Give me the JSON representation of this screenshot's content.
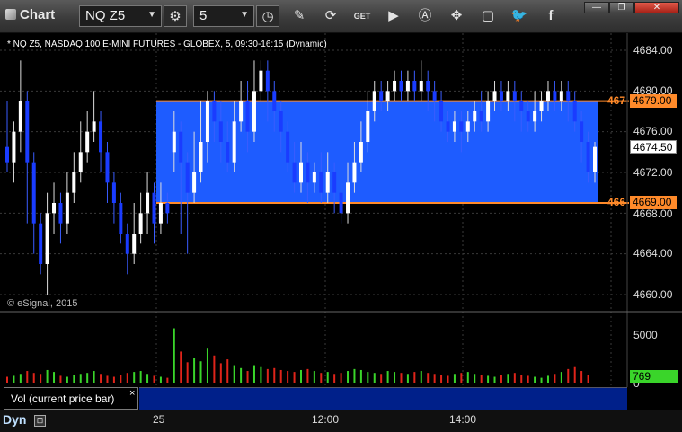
{
  "toolbar": {
    "title": "Chart",
    "symbol": "NQ Z5",
    "interval": "5",
    "icons": [
      "clock-settings-icon",
      "interval-clock-icon",
      "pencil-icon",
      "refresh-icon",
      "get-icon",
      "play-icon",
      "alert-icon",
      "link-icon",
      "chat-icon",
      "twitter-icon",
      "facebook-icon"
    ],
    "get_label": "GET"
  },
  "chart": {
    "header": "* NQ Z5, NASDAQ 100 E-MINI FUTURES - GLOBEX, 5, 09:30-16:15 (Dynamic)",
    "copyright": "© eSignal, 2015",
    "price_axis": [
      "4684.00",
      "4680.00",
      "4676.00",
      "4672.00",
      "4668.00",
      "4664.00",
      "4660.00"
    ],
    "upper_line": "4679.00",
    "lower_line": "4669.00",
    "upper_cut": "467",
    "lower_cut": "466",
    "last_price": "4674.50",
    "accent": "#ff8a2a",
    "zone_color": "#1e5cff"
  },
  "volume": {
    "label": "Vol (current price bar)",
    "close": "×",
    "axis": [
      "5000",
      "0"
    ],
    "last": "769"
  },
  "bottom": {
    "dyn": "Dyn",
    "ticks": [
      "25",
      "12:00",
      "14:00"
    ]
  },
  "chart_data": {
    "type": "candlestick",
    "title": "* NQ Z5, NASDAQ 100 E-MINI FUTURES - GLOBEX, 5, 09:30-16:15 (Dynamic)",
    "ylim": [
      4658,
      4686
    ],
    "zone": [
      4669,
      4679
    ],
    "candles": [
      [
        4674.5,
        4673,
        4679,
        4672
      ],
      [
        4673,
        4676,
        4677,
        4671
      ],
      [
        4676,
        4679,
        4683,
        4674
      ],
      [
        4679,
        4673,
        4680,
        4667
      ],
      [
        4673,
        4667,
        4674,
        4664
      ],
      [
        4667,
        4663,
        4668,
        4662
      ],
      [
        4663,
        4668,
        4670,
        4660
      ],
      [
        4668,
        4669,
        4671,
        4666
      ],
      [
        4669,
        4667,
        4670,
        4665
      ],
      [
        4667,
        4670,
        4672,
        4666
      ],
      [
        4670,
        4672,
        4674,
        4669
      ],
      [
        4672,
        4674,
        4677,
        4671
      ],
      [
        4674,
        4676,
        4678,
        4673
      ],
      [
        4676,
        4677,
        4680,
        4675
      ],
      [
        4677,
        4674,
        4678,
        4672
      ],
      [
        4674,
        4671,
        4675,
        4669
      ],
      [
        4671,
        4669,
        4672,
        4667
      ],
      [
        4669,
        4666,
        4670,
        4665
      ],
      [
        4666,
        4664,
        4667,
        4662
      ],
      [
        4664,
        4666,
        4669,
        4663
      ],
      [
        4666,
        4668,
        4670,
        4665
      ],
      [
        4668,
        4670,
        4672,
        4666
      ],
      [
        4670,
        4667,
        4671,
        4665
      ],
      [
        4667,
        4669,
        4671,
        4666
      ],
      [
        4669,
        4668,
        4670,
        4667
      ],
      [
        4674,
        4676,
        4678,
        4672
      ],
      [
        4676,
        4673,
        4677,
        4666
      ],
      [
        4673,
        4670,
        4674,
        4664
      ],
      [
        4670,
        4672,
        4676,
        4669
      ],
      [
        4672,
        4675,
        4679,
        4671
      ],
      [
        4675,
        4679,
        4680,
        4673
      ],
      [
        4679,
        4677,
        4680,
        4675
      ],
      [
        4677,
        4675,
        4679,
        4673
      ],
      [
        4675,
        4673,
        4677,
        4672
      ],
      [
        4673,
        4677,
        4679,
        4672
      ],
      [
        4677,
        4679,
        4681,
        4676
      ],
      [
        4679,
        4676,
        4681,
        4674
      ],
      [
        4676,
        4680,
        4683,
        4675
      ],
      [
        4680,
        4682,
        4683,
        4679
      ],
      [
        4682,
        4680,
        4683,
        4677
      ],
      [
        4680,
        4678,
        4681,
        4676
      ],
      [
        4678,
        4676,
        4679,
        4674
      ],
      [
        4676,
        4673,
        4677,
        4672
      ],
      [
        4673,
        4671,
        4675,
        4670
      ],
      [
        4671,
        4673,
        4675,
        4670
      ],
      [
        4673,
        4671,
        4674,
        4669
      ],
      [
        4671,
        4672,
        4673,
        4670
      ],
      [
        4672,
        4670,
        4674,
        4669
      ],
      [
        4670,
        4672,
        4674,
        4669
      ],
      [
        4672,
        4670,
        4673,
        4668
      ],
      [
        4670,
        4668,
        4671,
        4667
      ],
      [
        4668,
        4671,
        4673,
        4667
      ],
      [
        4671,
        4673,
        4675,
        4670
      ],
      [
        4673,
        4675,
        4677,
        4672
      ],
      [
        4675,
        4678,
        4680,
        4674
      ],
      [
        4678,
        4680,
        4681,
        4677
      ],
      [
        4680,
        4679,
        4681,
        4678
      ],
      [
        4679,
        4680,
        4681,
        4678
      ],
      [
        4680,
        4681,
        4682,
        4679
      ],
      [
        4681,
        4680,
        4682,
        4679
      ],
      [
        4680,
        4681,
        4682,
        4679
      ],
      [
        4681,
        4680,
        4682,
        4679
      ],
      [
        4680,
        4681,
        4683,
        4679
      ],
      [
        4681,
        4680,
        4682,
        4678
      ],
      [
        4680,
        4679,
        4681,
        4677
      ],
      [
        4679,
        4677,
        4680,
        4676
      ],
      [
        4677,
        4676,
        4678,
        4675
      ],
      [
        4676,
        4677,
        4678,
        4675
      ],
      [
        4677,
        4676,
        4678,
        4674
      ],
      [
        4676,
        4677,
        4678,
        4675
      ],
      [
        4677,
        4678,
        4679,
        4676
      ],
      [
        4678,
        4677,
        4680,
        4676
      ],
      [
        4677,
        4679,
        4680,
        4676
      ],
      [
        4679,
        4680,
        4681,
        4678
      ],
      [
        4680,
        4679,
        4681,
        4678
      ],
      [
        4679,
        4680,
        4681,
        4678
      ],
      [
        4680,
        4679,
        4681,
        4677
      ],
      [
        4679,
        4678,
        4680,
        4676
      ],
      [
        4678,
        4677,
        4679,
        4676
      ],
      [
        4677,
        4678,
        4680,
        4676
      ],
      [
        4678,
        4679,
        4680,
        4677
      ],
      [
        4679,
        4680,
        4681,
        4678
      ],
      [
        4680,
        4679,
        4681,
        4678
      ],
      [
        4679,
        4680,
        4681,
        4678
      ],
      [
        4680,
        4679,
        4681,
        4677
      ],
      [
        4679,
        4677,
        4680,
        4676
      ],
      [
        4677,
        4675,
        4678,
        4673
      ],
      [
        4675,
        4672,
        4676,
        4671
      ],
      [
        4672,
        4674.5,
        4675,
        4671
      ]
    ],
    "volume": [
      600,
      700,
      900,
      1200,
      1000,
      900,
      1300,
      1100,
      700,
      600,
      800,
      900,
      1000,
      1200,
      900,
      700,
      600,
      800,
      1000,
      1100,
      1200,
      900,
      700,
      600,
      500,
      5600,
      3200,
      2100,
      2500,
      2200,
      3500,
      2800,
      2000,
      2400,
      1800,
      1500,
      1200,
      1800,
      1600,
      1400,
      1500,
      1300,
      1200,
      1100,
      1300,
      1400,
      1200,
      1000,
      1100,
      900,
      1000,
      1200,
      1400,
      1300,
      1100,
      1000,
      900,
      1200,
      1100,
      1000,
      900,
      1100,
      1200,
      1000,
      900,
      800,
      700,
      900,
      1000,
      1100,
      900,
      800,
      700,
      600,
      800,
      900,
      1000,
      800,
      700,
      600,
      500,
      700,
      900,
      1100,
      1400,
      1600,
      1200,
      769
    ]
  }
}
